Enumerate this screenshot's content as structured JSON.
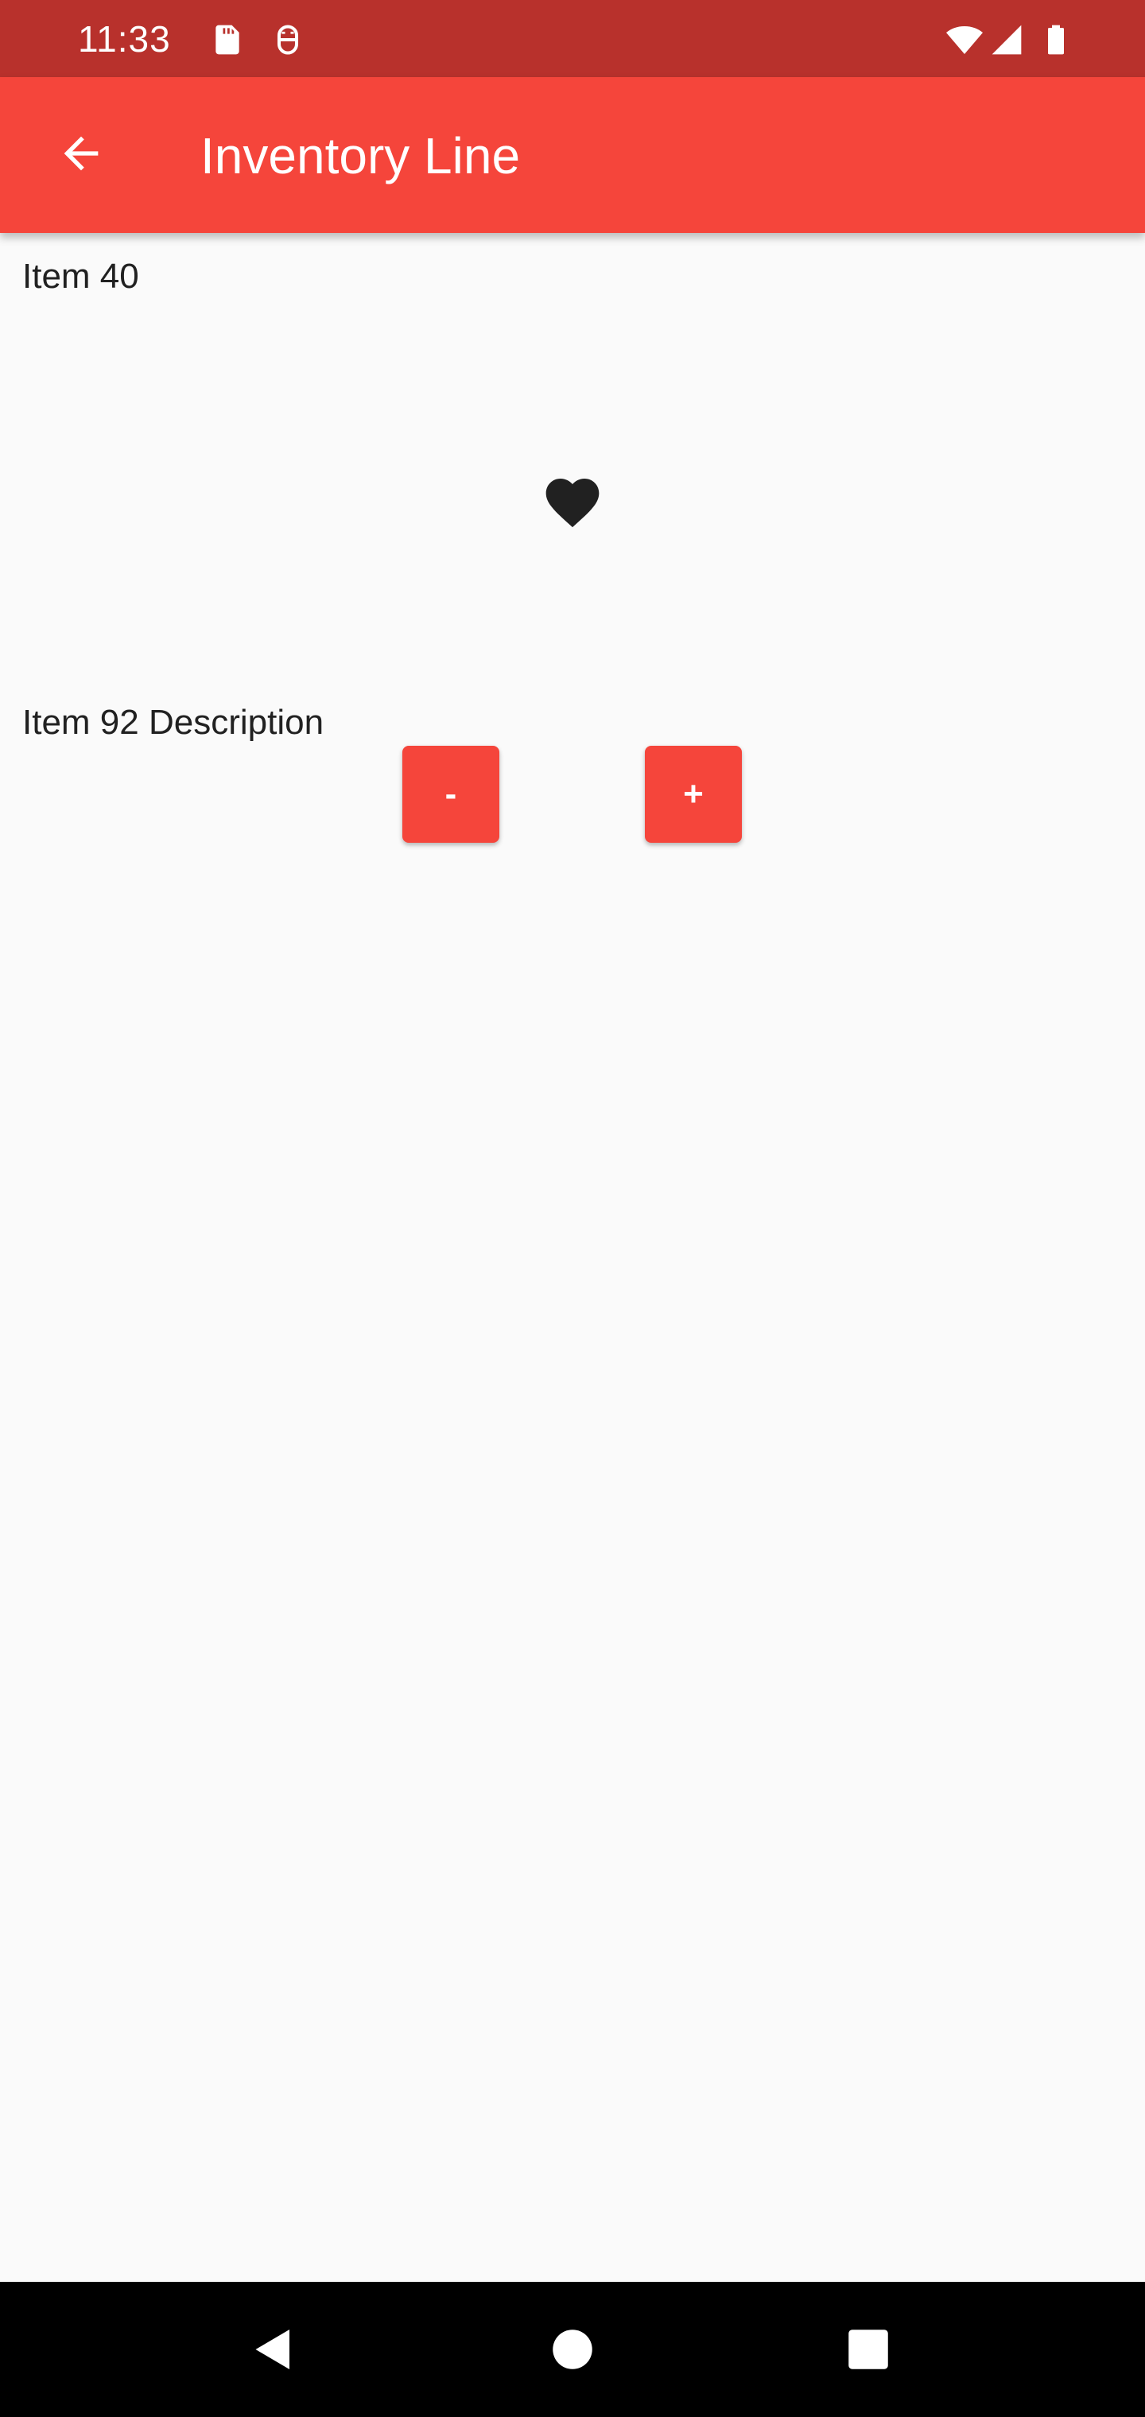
{
  "status_bar": {
    "time": "11:33",
    "icons": [
      "sd-card-icon",
      "android-debug-icon",
      "wifi-icon",
      "signal-icon",
      "battery-icon"
    ]
  },
  "app_bar": {
    "title": "Inventory Line",
    "back_icon": "arrow-back-icon"
  },
  "item": {
    "title": "Item 40",
    "favorite_icon": "heart-icon",
    "description": "Item 92 Description",
    "decrease_label": "-",
    "increase_label": "+"
  },
  "nav_bar": {
    "icons": [
      "back-triangle-icon",
      "home-circle-icon",
      "recents-square-icon"
    ]
  },
  "colors": {
    "status_bar": "#b8312c",
    "app_bar": "#f5453b",
    "accent": "#f5453b",
    "background": "#fafafa",
    "text": "#212121"
  }
}
